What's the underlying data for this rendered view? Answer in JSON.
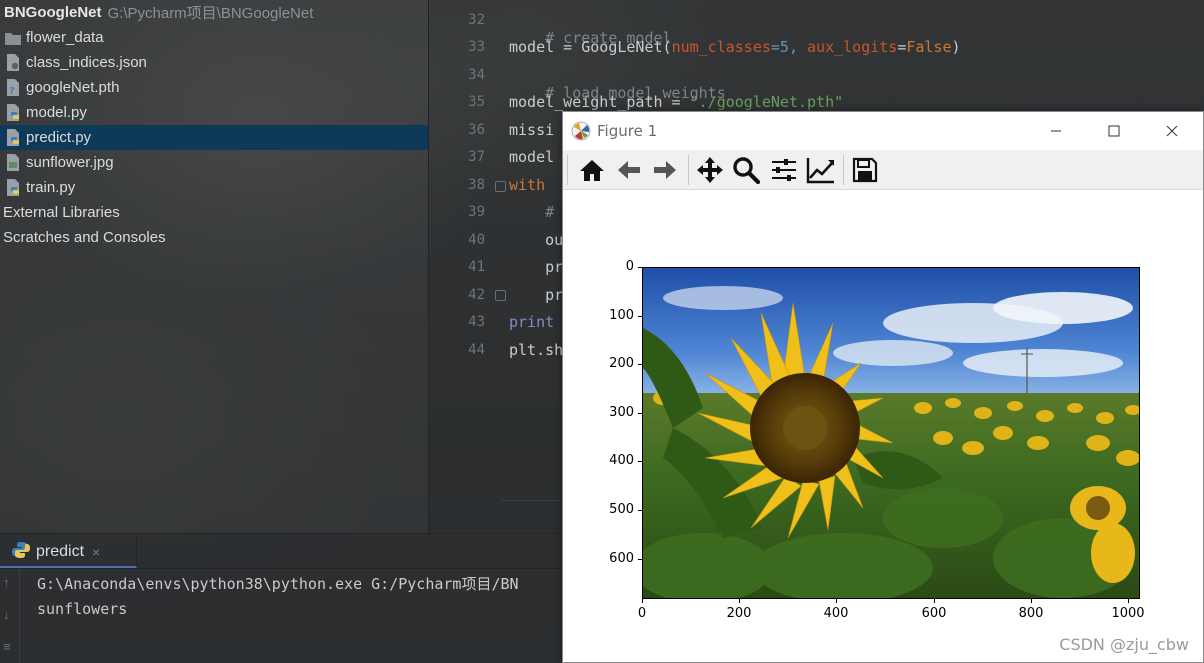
{
  "project": {
    "name": "BNGoogleNet",
    "path": "G:\\Pycharm项目\\BNGoogleNet",
    "items": [
      {
        "label": "flower_data",
        "icon": "folder-icon"
      },
      {
        "label": "class_indices.json",
        "icon": "json-file-icon"
      },
      {
        "label": "googleNet.pth",
        "icon": "python-file-icon"
      },
      {
        "label": "model.py",
        "icon": "python-file-icon"
      },
      {
        "label": "predict.py",
        "icon": "python-file-icon"
      },
      {
        "label": "sunflower.jpg",
        "icon": "image-file-icon"
      },
      {
        "label": "train.py",
        "icon": "python-file-icon"
      },
      {
        "label": "External Libraries",
        "icon": ""
      },
      {
        "label": "Scratches and Consoles",
        "icon": ""
      }
    ],
    "selected_index": 4
  },
  "editor": {
    "line_numbers": [
      "32",
      "33",
      "34",
      "35",
      "36",
      "37",
      "38",
      "39",
      "40",
      "41",
      "42",
      "43",
      "44"
    ],
    "lines": {
      "l32": "# create model",
      "l33_a": "model = GoogLeNet(",
      "l33_b": "num_classes",
      "l33_c": "=5, ",
      "l33_d": "aux_logits",
      "l33_e": "=",
      "l33_f": "False",
      "l33_g": ")",
      "l34": "# load model weights",
      "l35_a": "model_weight_path = ",
      "l35_b": "\"./googleNet.pth\"",
      "l36": "missi",
      "l37": "model",
      "l38": "with ",
      "l39": "    #",
      "l40": "    ou",
      "l41": "    pr",
      "l42": "    pr",
      "l43": "print",
      "l44": "plt.sh"
    }
  },
  "run": {
    "tab_label": "predict",
    "close_glyph": "×",
    "console": [
      "G:\\Anaconda\\envs\\python38\\python.exe G:/Pycharm项目/BN",
      "sunflowers"
    ]
  },
  "figure": {
    "title": "Figure 1",
    "toolbar": [
      "home-icon",
      "back-icon",
      "forward-icon",
      "pan-icon",
      "zoom-icon",
      "configure-subplots-icon",
      "edit-axis-icon",
      "save-icon"
    ],
    "image_description": "sunflower.jpg"
  },
  "chart_data": {
    "type": "image",
    "title": "",
    "xlabel": "",
    "ylabel": "",
    "xticks": [
      0,
      200,
      400,
      600,
      800,
      1000
    ],
    "yticks": [
      0,
      100,
      200,
      300,
      400,
      500,
      600
    ],
    "xlim": [
      0,
      1024
    ],
    "ylim": [
      683,
      0
    ],
    "grid": false
  },
  "watermark": "CSDN @zju_cbw",
  "colors": {
    "selection": "#0e3a5a",
    "comment": "#7f848a",
    "keyword": "#cc7832",
    "string": "#6a9e5b"
  }
}
